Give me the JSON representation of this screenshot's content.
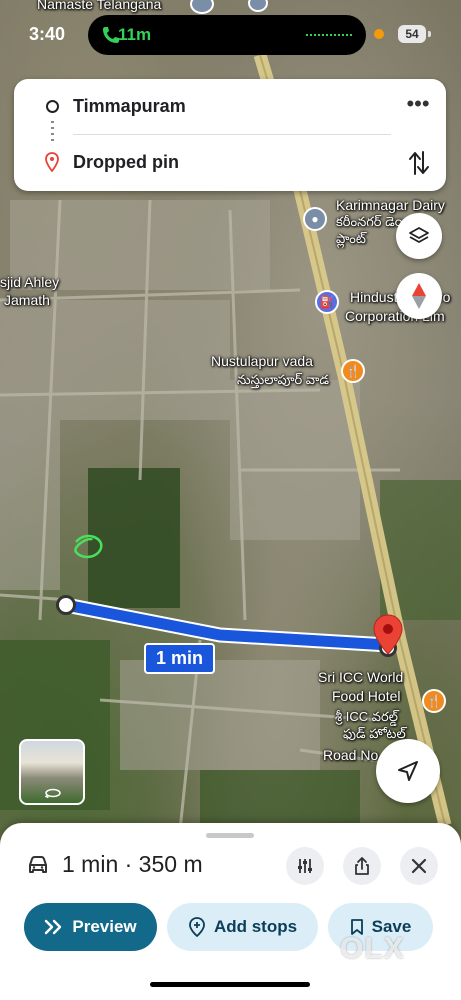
{
  "status_bar": {
    "time": "3:40",
    "call_duration": "11m",
    "battery": "54"
  },
  "top_partial_label": "Namaste Telangana",
  "route_card": {
    "origin": "Timmapuram",
    "destination": "Dropped pin",
    "more_icon": "more-dots-icon",
    "swap_icon": "swap-vertical-icon"
  },
  "map_labels": {
    "karimnagar_dairy": "Karimnagar Dairy",
    "karimnagar_dairy_te": "కరీంనగర్ డెయిరీ",
    "plant_te": "ప్లాంట్",
    "masjid": "sjid Ahley",
    "jamath": "Jamath",
    "hindustan_petroleum": "Hindustan Petro",
    "corporation": "Corporation Lim",
    "nustulapur": "Nustulapur vada",
    "nustulapur_te": "నుస్తులాపూర్ వాడ",
    "sri_icc": "Sri ICC World",
    "food_hotel": "Food Hotel",
    "sri_icc_te": "శ్రీ ICC వరల్డ్",
    "food_hotel_te": "ఫుడ్ హోటల్",
    "road_no": "Road No"
  },
  "route": {
    "duration_label": "1 min",
    "color": "#1a56db"
  },
  "bottom_sheet": {
    "summary": "1 min · 350 m",
    "mode_icon": "car-icon",
    "preview_label": "Preview",
    "add_stops_label": "Add stops",
    "save_label": "Save"
  },
  "watermark": "OLX",
  "colors": {
    "preview_button": "#12698a",
    "secondary_button": "#dbeef8",
    "destination_pin": "#ea4335",
    "poi_orange": "#f28b1f"
  }
}
